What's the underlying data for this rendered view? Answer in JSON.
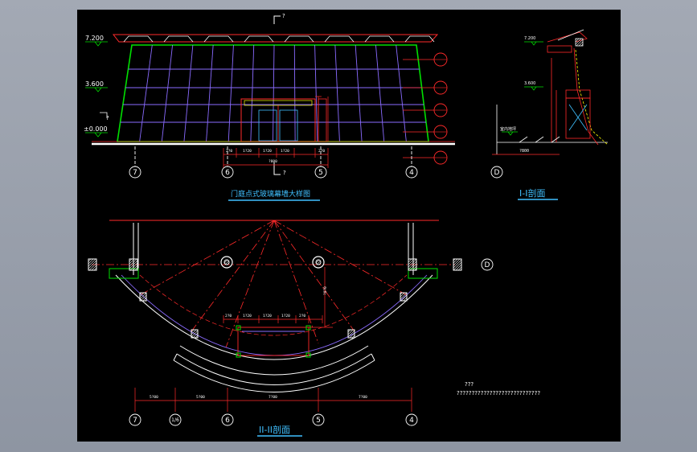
{
  "colors": {
    "background": "#000000",
    "frame": "#9aa0ac",
    "green": "#00e000",
    "grid": "#8a6bff",
    "red": "#ff2a2a",
    "white": "#ffffff",
    "yellow": "#ffff00",
    "cyan": "#40c0ff"
  },
  "elevation": {
    "levels": [
      "7.200",
      "3.600",
      "±0.000"
    ],
    "section_marks": [
      "?",
      "?"
    ],
    "dims_bottom": [
      "2?0",
      "1?20",
      "1?20",
      "1?20",
      "2?0"
    ],
    "dim_total": "?800",
    "title": "门庭点式玻璃幕墙大样图"
  },
  "section_one": {
    "title": "I-I剖面",
    "levels": [
      "7.200",
      "3.600",
      "±0.000"
    ],
    "label_left": "室内地坪",
    "dim": "?800",
    "axis": "D"
  },
  "plan": {
    "title": "II-II剖面",
    "dims_top": [
      "2?0",
      "1?20",
      "1?20",
      "1?20",
      "2?0"
    ],
    "dims_bottom": [
      "5?00",
      "5?00",
      "7?00",
      "7?00"
    ],
    "vertical_dim": "?8?0",
    "axis_right": "D"
  },
  "axes": {
    "elevation": [
      "7",
      "6",
      "5",
      "4"
    ],
    "plan": [
      "7",
      "1/6",
      "6",
      "5",
      "4"
    ]
  },
  "notes": {
    "title": "???",
    "body": "????????????????????????????"
  }
}
